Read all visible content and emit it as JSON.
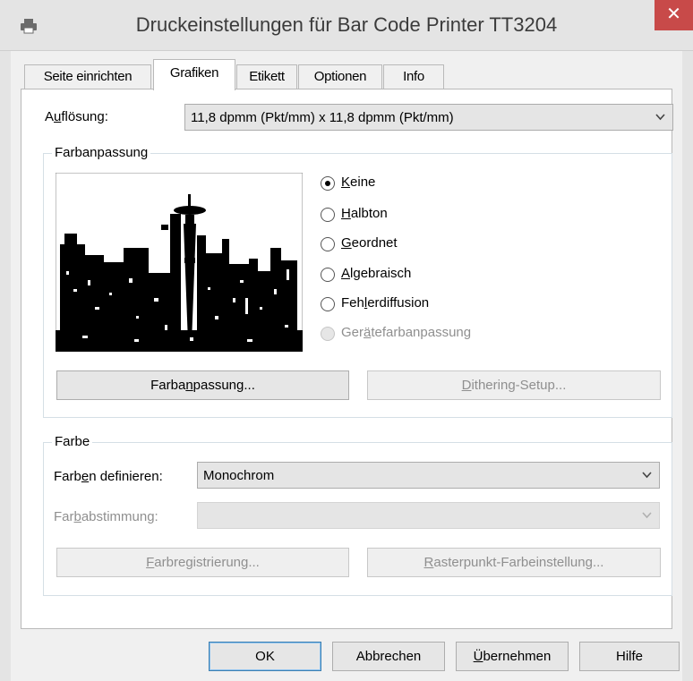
{
  "window": {
    "title": "Druckeinstellungen für Bar Code Printer TT3204",
    "close_glyph": "✕"
  },
  "tabs": [
    {
      "label": "Seite einrichten",
      "active": false
    },
    {
      "label": "Grafiken",
      "active": true
    },
    {
      "label": "Etikett",
      "active": false
    },
    {
      "label": "Optionen",
      "active": false
    },
    {
      "label": "Info",
      "active": false
    }
  ],
  "resolution": {
    "label_pre": "A",
    "label_u": "u",
    "label_post": "flösung:",
    "value": "11,8 dpmm (Pkt/mm) x 11,8 dpmm (Pkt/mm)"
  },
  "color_matching": {
    "group_label": "Farbanpassung",
    "preview_icon": "city-skyline-dither-icon",
    "options": [
      {
        "pre": "",
        "u": "K",
        "post": "eine",
        "selected": true,
        "enabled": true
      },
      {
        "pre": "",
        "u": "H",
        "post": "albton",
        "selected": false,
        "enabled": true
      },
      {
        "pre": "",
        "u": "G",
        "post": "eordnet",
        "selected": false,
        "enabled": true
      },
      {
        "pre": "",
        "u": "A",
        "post": "lgebraisch",
        "selected": false,
        "enabled": true
      },
      {
        "pre": "Feh",
        "u": "l",
        "post": "erdiffusion",
        "selected": false,
        "enabled": true
      },
      {
        "pre": "Ger",
        "u": "ä",
        "post": "tefarbanpassung",
        "selected": false,
        "enabled": false
      }
    ],
    "btn_matching": {
      "pre": "Farba",
      "u": "n",
      "post": "passung..."
    },
    "btn_dithering": {
      "pre": "",
      "u": "D",
      "post": "ithering-Setup..."
    }
  },
  "color": {
    "group_label": "Farbe",
    "define_label": {
      "pre": "Farb",
      "u": "e",
      "post": "n definieren:"
    },
    "define_value": "Monochrom",
    "tuning_label": {
      "pre": "Far",
      "u": "b",
      "post": "abstimmung:"
    },
    "tuning_value": "",
    "btn_registration": {
      "pre": "",
      "u": "F",
      "post": "arbregistrierung..."
    },
    "btn_raster": {
      "pre": "",
      "u": "R",
      "post": "asterpunkt-Farbeinstellung..."
    }
  },
  "footer": {
    "ok": "OK",
    "cancel": "Abbrechen",
    "apply": {
      "pre": "",
      "u": "Ü",
      "post": "bernehmen"
    },
    "help": "Hilfe"
  },
  "colors": {
    "close_button": "#c84a49",
    "titlebar": "#e4e4e4",
    "dialog_bg": "#f0f0f0",
    "default_button_border": "#3c7fb1"
  }
}
